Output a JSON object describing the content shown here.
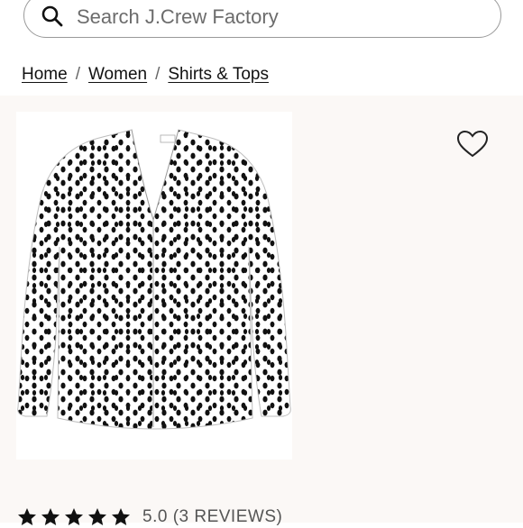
{
  "search": {
    "placeholder": "Search J.Crew Factory",
    "icon": "search-icon"
  },
  "breadcrumb": {
    "items": [
      "Home",
      "Women",
      "Shirts & Tops"
    ],
    "separator": "/"
  },
  "product": {
    "image_description_icon": "blouse-image",
    "favorite_icon": "heart-icon",
    "rating_value": 5,
    "rating_text": "5.0 (3 REVIEWS)"
  },
  "colors": {
    "panel_background": "#fbf8f6",
    "text": "#111111"
  }
}
